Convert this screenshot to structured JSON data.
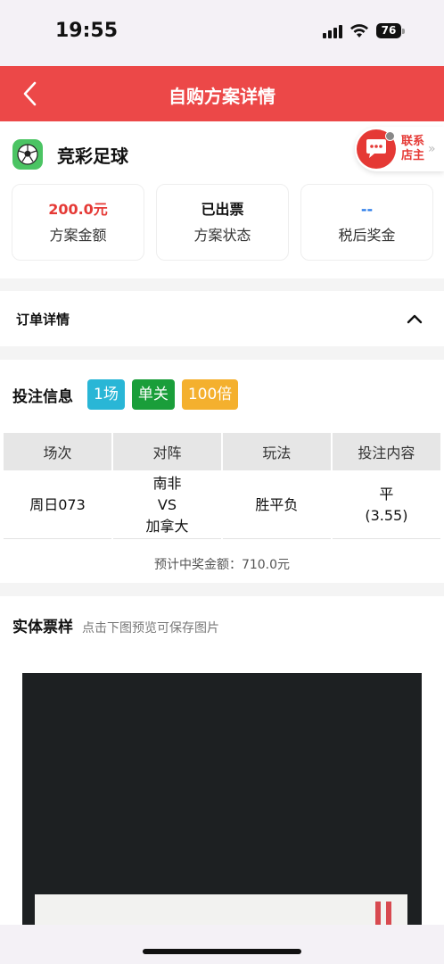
{
  "status_bar": {
    "time": "19:55",
    "battery": "76",
    "icons": [
      "signal-icon",
      "wifi-icon",
      "battery-icon"
    ]
  },
  "nav": {
    "title": "自购方案详情",
    "back_icon": "chevron-left-icon",
    "background": "#ec4848"
  },
  "lottery": {
    "name": "竞彩足球",
    "icon": "soccer-ball-icon"
  },
  "contact": {
    "label": "联系店主",
    "icon": "chat-bubble-icon"
  },
  "stats": [
    {
      "value": "200.0元",
      "label": "方案金额",
      "color": "#e53935"
    },
    {
      "value": "已出票",
      "label": "方案状态",
      "color": "#111111"
    },
    {
      "value": "--",
      "label": "税后奖金",
      "color": "#2b7de9"
    }
  ],
  "order": {
    "title": "订单详情",
    "toggle_icon": "chevron-up-icon"
  },
  "bet": {
    "title": "投注信息",
    "tags": [
      {
        "label": "1场",
        "color": "#29b6d6"
      },
      {
        "label": "单关",
        "color": "#1a9e3a"
      },
      {
        "label": "100倍",
        "color": "#f4b02e"
      }
    ],
    "columns": [
      "场次",
      "对阵",
      "玩法",
      "投注内容"
    ],
    "rows": [
      {
        "match_no": "周日073",
        "home": "南非",
        "vs": "VS",
        "away": "加拿大",
        "play": "胜平负",
        "pick": "平",
        "odds": "(3.55)"
      }
    ],
    "expected_win": "预计中奖金额：710.0元"
  },
  "ticket": {
    "title": "实体票样",
    "hint": "点击下图预览可保存图片"
  }
}
